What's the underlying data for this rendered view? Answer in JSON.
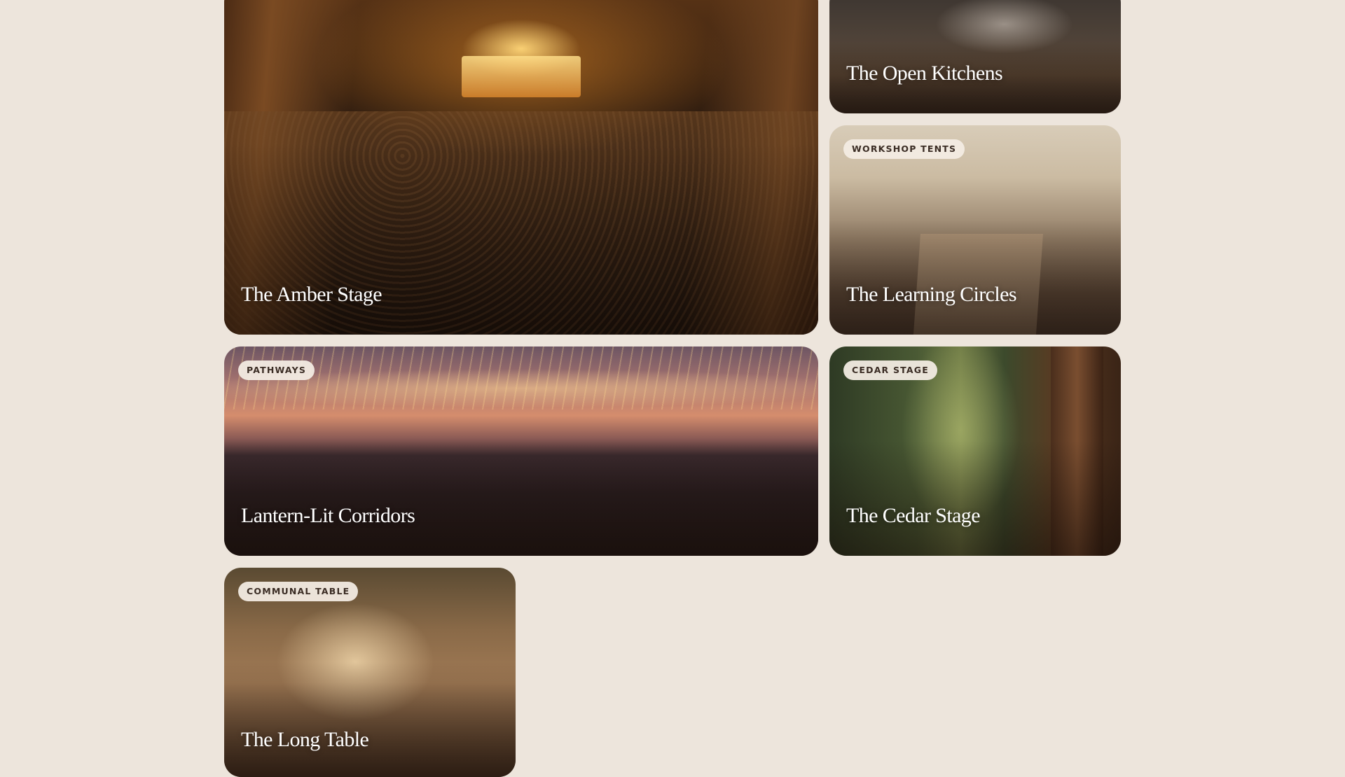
{
  "venues": [
    {
      "id": "amber",
      "tag": "",
      "title": "The Amber Stage"
    },
    {
      "id": "kitchens",
      "tag": "",
      "title": "The Open Kitchens"
    },
    {
      "id": "learning",
      "tag": "WORKSHOP TENTS",
      "title": "The Learning Circles"
    },
    {
      "id": "lantern",
      "tag": "PATHWAYS",
      "title": "Lantern-Lit Corridors"
    },
    {
      "id": "cedar",
      "tag": "CEDAR STAGE",
      "title": "The Cedar Stage"
    },
    {
      "id": "long",
      "tag": "COMMUNAL TABLE",
      "title": "The Long Table"
    }
  ],
  "colors": {
    "page_background": "#ede5dc",
    "chip_background": "#f3ece3",
    "chip_text": "#3a2c24",
    "title_text": "#ffffff"
  }
}
